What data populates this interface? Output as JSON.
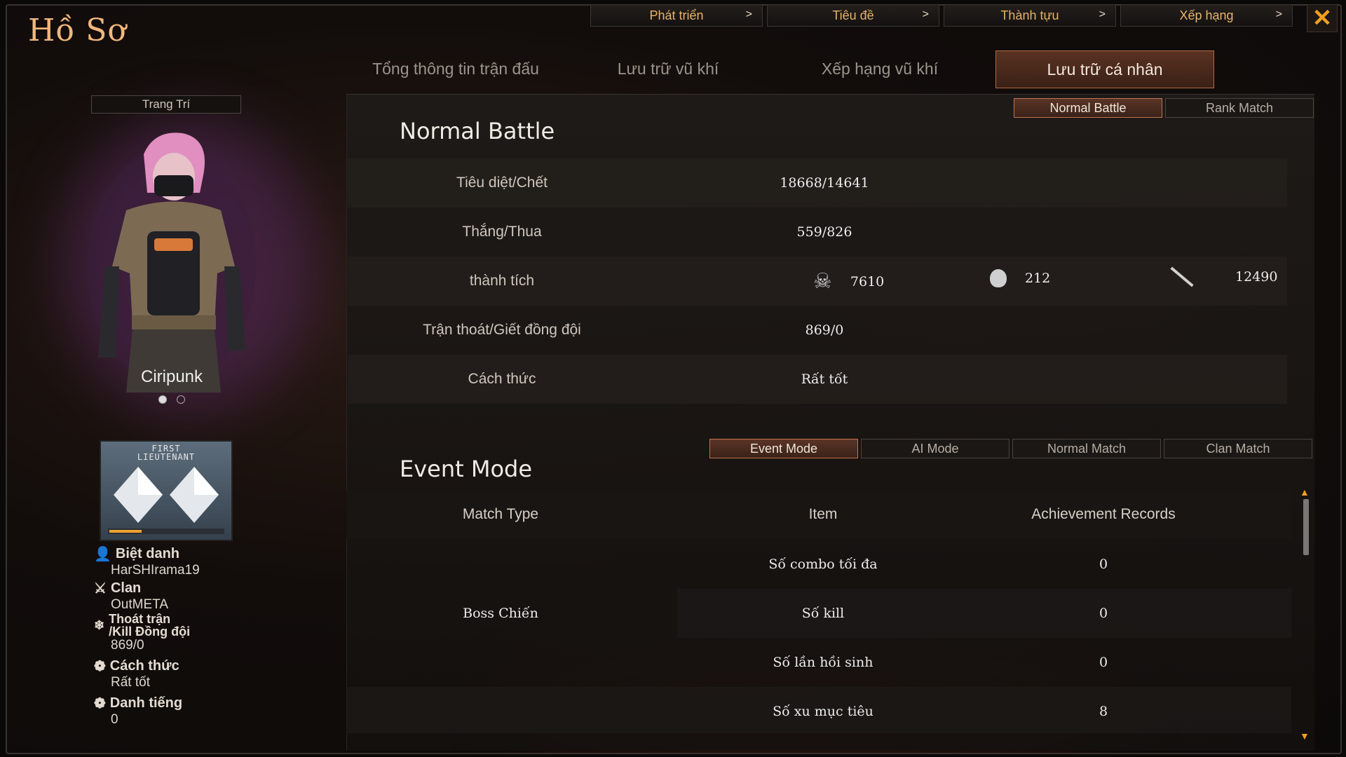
{
  "header": {
    "title": "Hồ Sơ"
  },
  "top_nav": [
    {
      "label": "Phát triển"
    },
    {
      "label": "Tiêu đề"
    },
    {
      "label": "Thành tựu"
    },
    {
      "label": "Xếp hạng"
    }
  ],
  "chevron": ">",
  "close_glyph": "✕",
  "tabs": [
    {
      "label": "Tổng thông tin trận đấu"
    },
    {
      "label": "Lưu trữ vũ khí"
    },
    {
      "label": "Xếp hạng vũ khí"
    },
    {
      "label": "Lưu trữ cá nhân"
    }
  ],
  "profile": {
    "deco_label": "Trang Trí",
    "character_name": "Ciripunk",
    "rank_text": "FIRST\nLIEUTENANT",
    "nickname_label": "Biệt danh",
    "nickname": "HarSHIrama19",
    "clan_label": "Clan",
    "clan": "OutMETA",
    "escape_label": "Thoát trận\n/Kill Đồng đội",
    "escape_value": "869/0",
    "manner_label": "Cách thức",
    "manner_value": "Rất tốt",
    "reputation_label": "Danh tiếng",
    "reputation_value": "0"
  },
  "battle_mode_buttons": [
    {
      "label": "Normal Battle"
    },
    {
      "label": "Rank Match"
    }
  ],
  "normal_battle": {
    "heading": "Normal Battle",
    "kd_label": "Tiêu diệt/Chết",
    "kd_value": "18668/14641",
    "wl_label": "Thắng/Thua",
    "wl_value": "559/826",
    "ach_label": "thành tích",
    "headshot": "7610",
    "grenade": "212",
    "knife": "12490",
    "escape_label": "Trận thoát/Giết đồng đội",
    "escape_value": "869/0",
    "manner_label": "Cách thức",
    "manner_value": "Rất tốt"
  },
  "event_mode_buttons": [
    {
      "label": "Event Mode"
    },
    {
      "label": "AI Mode"
    },
    {
      "label": "Normal Match"
    },
    {
      "label": "Clan Match"
    }
  ],
  "event_mode": {
    "heading": "Event Mode",
    "columns": [
      "Match Type",
      "Item",
      "Achievement Records"
    ],
    "match_type": "Boss Chiến",
    "rows": [
      {
        "item": "Số combo tối đa",
        "value": "0"
      },
      {
        "item": "Số kill",
        "value": "0"
      },
      {
        "item": "Số lần hồi sinh",
        "value": "0"
      },
      {
        "item": "Số xu mục tiêu",
        "value": "8"
      }
    ]
  },
  "colors": {
    "accent": "#e8b36a",
    "title": "#f2b77d",
    "active_tab": "#5a3222"
  }
}
